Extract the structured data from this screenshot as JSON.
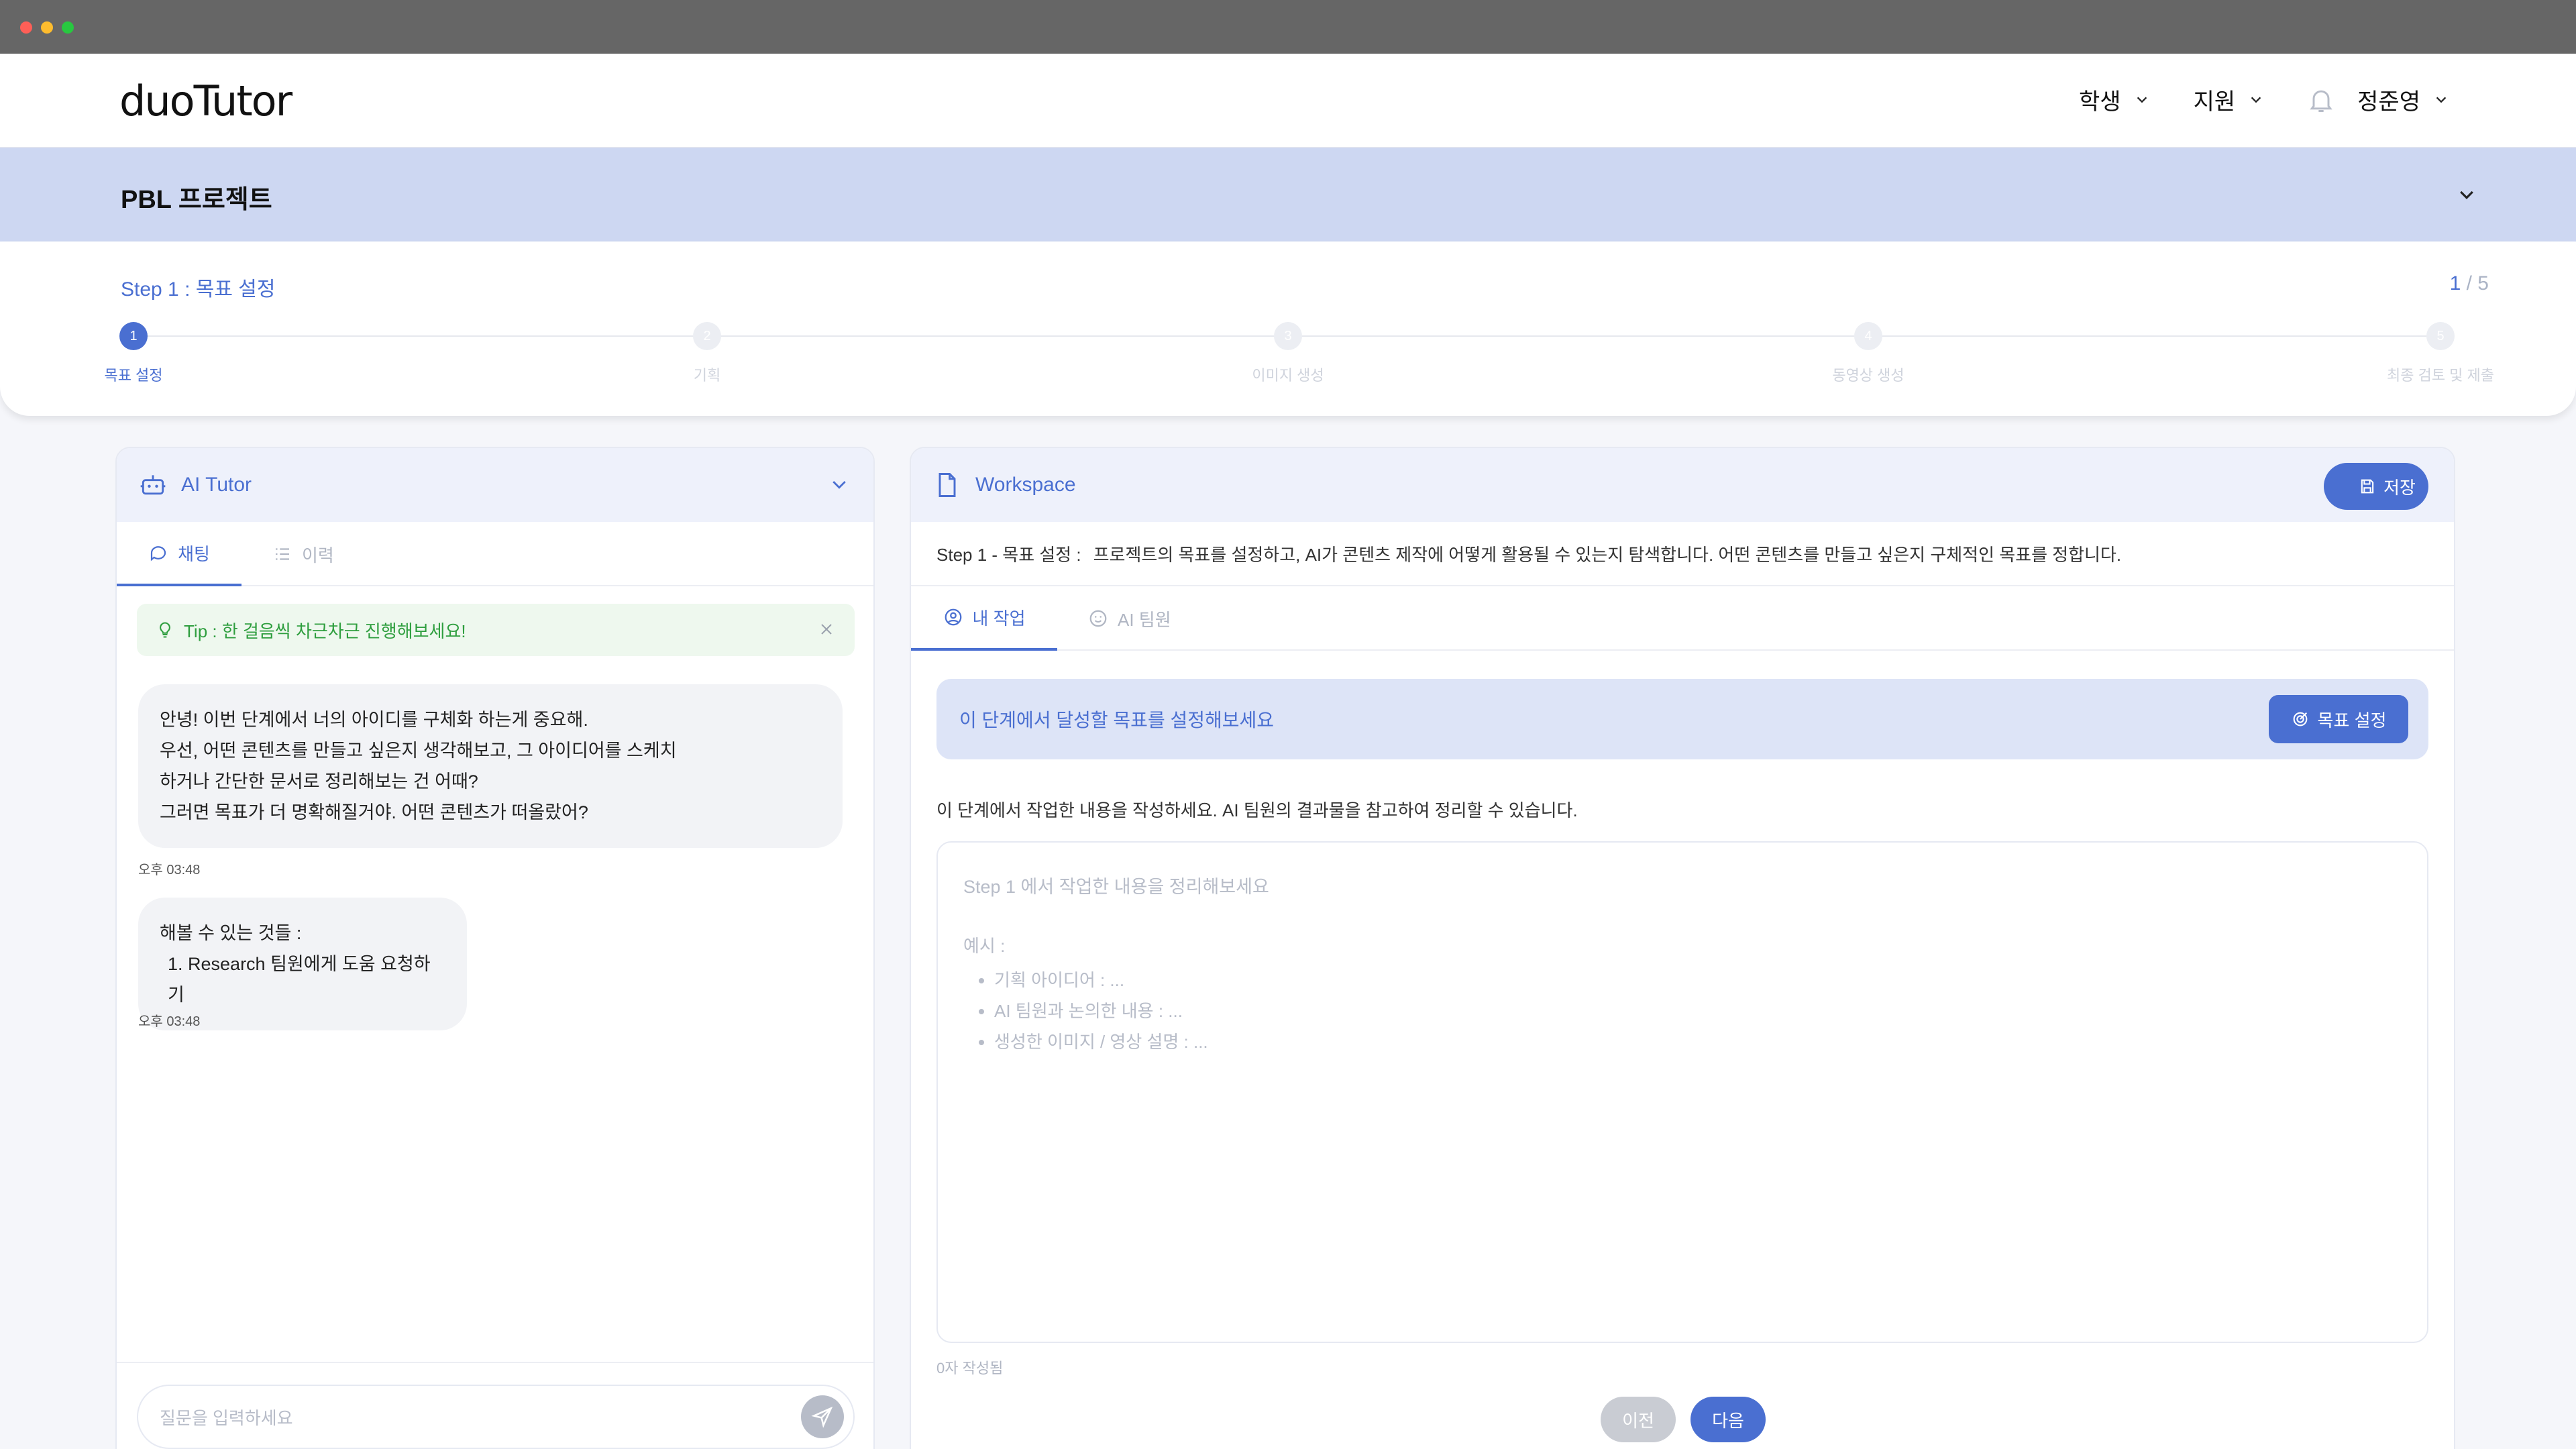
{
  "app": {
    "logo": "duoTutor",
    "nav": {
      "student": "학생",
      "support": "지원",
      "user": "정준영"
    }
  },
  "project": {
    "title": "PBL 프로젝트"
  },
  "steps": {
    "title": "Step 1 : 목표 설정",
    "current": "1",
    "total": "/ 5",
    "items": [
      {
        "num": "1",
        "label": "목표 설정"
      },
      {
        "num": "2",
        "label": "기획"
      },
      {
        "num": "3",
        "label": "이미지 생성"
      },
      {
        "num": "4",
        "label": "동영상 생성"
      },
      {
        "num": "5",
        "label": "최종 검토 및 제출"
      }
    ]
  },
  "tutor": {
    "title": "AI Tutor",
    "tabs": {
      "chat": "채팅",
      "history": "이력"
    },
    "tip": "Tip : 한 걸음씩 차근차근 진행해보세요!",
    "messages": [
      {
        "lines": [
          "안녕! 이번 단계에서 너의 아이디를 구체화 하는게 중요해.",
          "우선, 어떤 콘텐츠를 만들고 싶은지 생각해보고, 그 아이디어를 스케치",
          "하거나 간단한 문서로 정리해보는 건 어때?",
          "그러면 목표가 더 명확해질거야. 어떤 콘텐츠가 떠올랐어?"
        ],
        "time": "오후 03:48"
      },
      {
        "lines": [
          "해볼 수 있는 것들 :",
          "1. Research 팀원에게 도움 요청하기"
        ],
        "time": "오후 03:48"
      }
    ],
    "input_placeholder": "질문을 입력하세요"
  },
  "workspace": {
    "title": "Workspace",
    "save": "저장",
    "step_label": "Step 1 - 목표 설정 :",
    "step_desc": "프로젝트의 목표를 설정하고, AI가 콘텐츠 제작에 어떻게 활용될 수 있는지 탐색합니다. 어떤 콘텐츠를 만들고 싶은지 구체적인 목표를 정합니다.",
    "tabs": {
      "mine": "내 작업",
      "ai_team": "AI 팀원"
    },
    "goal_text": "이 단계에서 달성할 목표를 설정해보세요",
    "goal_button": "목표 설정",
    "guide": "이 단계에서 작업한 내용을 작성하세요. AI 팀원의 결과물을 참고하여 정리할 수 있습니다.",
    "editor_placeholder": "Step 1 에서 작업한 내용을 정리해보세요",
    "example_title": "예시 :",
    "examples": [
      "기획 아이디어 : ...",
      "AI 팀원과 논의한 내용 : ...",
      "생성한 이미지 / 영상 설명 : ..."
    ],
    "char_count": "0자 작성됨",
    "prev": "이전",
    "next": "다음"
  },
  "colors": {
    "accent": "#4a6fd1",
    "project_bar": "#cdd7f2",
    "tip": "#2e9e3e"
  }
}
